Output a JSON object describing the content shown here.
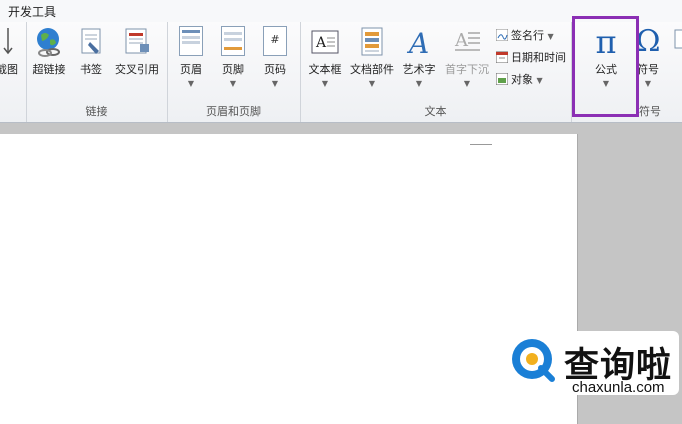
{
  "tab": "开发工具",
  "groups": {
    "links": "链接",
    "header_footer": "页眉和页脚",
    "text": "文本",
    "symbols": "符号"
  },
  "buttons": {
    "screenshot": "截图",
    "hyperlink": "超链接",
    "bookmark": "书签",
    "cross_ref": "交叉引用",
    "header": "页眉",
    "footer": "页脚",
    "page_number": "页码",
    "textbox": "文本框",
    "quick_parts": "文档部件",
    "wordart": "艺术字",
    "drop_cap": "首字下沉",
    "signature_line": "签名行",
    "date_time": "日期和时间",
    "object": "对象",
    "equation": "公式",
    "symbol": "符号",
    "equation_glyph": "π",
    "symbol_glyph": "Ω"
  },
  "watermark": {
    "chinese": "查询啦",
    "domain": "chaxunla.com"
  },
  "colors": {
    "highlight_border": "#8b2fb4",
    "watermark_blue": "#1a7fd6"
  }
}
